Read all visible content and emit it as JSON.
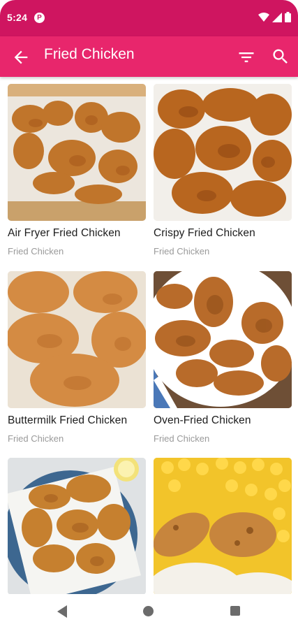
{
  "status_bar": {
    "time": "5:24",
    "app_icon_glyph": "P",
    "icons": [
      "wifi-icon",
      "signal-icon",
      "battery-icon"
    ]
  },
  "app_bar": {
    "title": "Fried Chicken",
    "icons": [
      "back-arrow-icon",
      "filter-icon",
      "search-icon"
    ]
  },
  "recipes": [
    {
      "title": "Air Fryer Fried Chicken",
      "category": "Fried Chicken"
    },
    {
      "title": "Crispy Fried Chicken",
      "category": "Fried Chicken"
    },
    {
      "title": "Buttermilk Fried Chicken",
      "category": "Fried Chicken"
    },
    {
      "title": "Oven-Fried Chicken",
      "category": "Fried Chicken"
    },
    {
      "title": "",
      "category": ""
    },
    {
      "title": "",
      "category": ""
    }
  ],
  "colors": {
    "status_bar": "#cf1560",
    "app_bar": "#e8266c",
    "title_text": "#1c1c1c",
    "subtitle_text": "#9a9a9a"
  },
  "nav_bar": {
    "icons": [
      "nav-back-icon",
      "nav-home-icon",
      "nav-recents-icon"
    ]
  }
}
